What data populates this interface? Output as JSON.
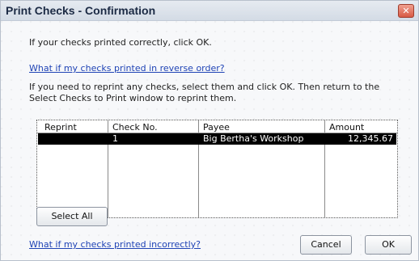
{
  "window": {
    "title": "Print Checks - Confirmation",
    "close_glyph": "✕"
  },
  "messages": {
    "line1": "If your checks printed correctly, click OK.",
    "reverse_link": "What if my checks printed in reverse order?",
    "reprint_line1": "If you need to reprint any checks, select them and click OK. Then return to the",
    "reprint_line2": "Select Checks to Print window to reprint them."
  },
  "table": {
    "headers": {
      "reprint": "Reprint",
      "check_no": "Check No.",
      "payee": "Payee",
      "amount": "Amount"
    },
    "rows": [
      {
        "reprint": "",
        "check_no": "1",
        "payee": "Big Bertha's Workshop",
        "amount": "12,345.67",
        "selected": true
      }
    ]
  },
  "buttons": {
    "select_all": "Select All",
    "cancel": "Cancel",
    "ok": "OK"
  },
  "footer": {
    "incorrect_link": "What if my checks printed incorrectly?"
  },
  "colors": {
    "link": "#1f43b5",
    "selection": "#000000",
    "close": "#d85a45"
  }
}
